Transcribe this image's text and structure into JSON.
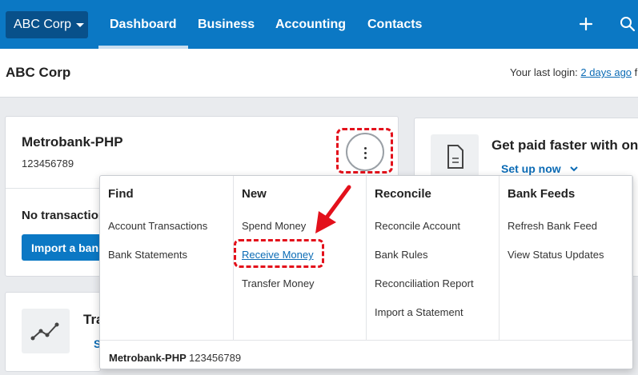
{
  "nav": {
    "org_button": "ABC Corp",
    "tabs": [
      "Dashboard",
      "Business",
      "Accounting",
      "Contacts"
    ],
    "active_tab": "Dashboard"
  },
  "header": {
    "org_title": "ABC Corp",
    "last_login_prefix": "Your last login: ",
    "last_login_link": "2 days ago",
    "last_login_suffix": " f"
  },
  "bank_card": {
    "name": "Metrobank-PHP",
    "account_number": "123456789",
    "no_transactions": "No transaction",
    "import_button": "Import a bank"
  },
  "paid_card": {
    "title": "Get paid faster with on",
    "setup_link": "Set up now"
  },
  "trans_card": {
    "title": "Tra",
    "sub": "S"
  },
  "dropdown": {
    "columns": [
      {
        "heading": "Find",
        "items": [
          "Account Transactions",
          "Bank Statements"
        ]
      },
      {
        "heading": "New",
        "items": [
          "Spend Money",
          "Receive Money",
          "Transfer Money"
        ]
      },
      {
        "heading": "Reconcile",
        "items": [
          "Reconcile Account",
          "Bank Rules",
          "Reconciliation Report",
          "Import a Statement"
        ]
      },
      {
        "heading": "Bank Feeds",
        "items": [
          "Refresh Bank Feed",
          "View Status Updates"
        ]
      }
    ],
    "footer_name": "Metrobank-PHP",
    "footer_account": "123456789"
  },
  "colors": {
    "nav_bg": "#0b78c4",
    "org_btn_bg": "#08508a",
    "link": "#0b6bb5",
    "highlight": "#e3101b"
  },
  "icons": [
    "caret-down-icon",
    "plus-icon",
    "search-icon",
    "kebab-icon",
    "document-icon",
    "chevron-down-icon",
    "trend-icon",
    "arrow-icon"
  ]
}
